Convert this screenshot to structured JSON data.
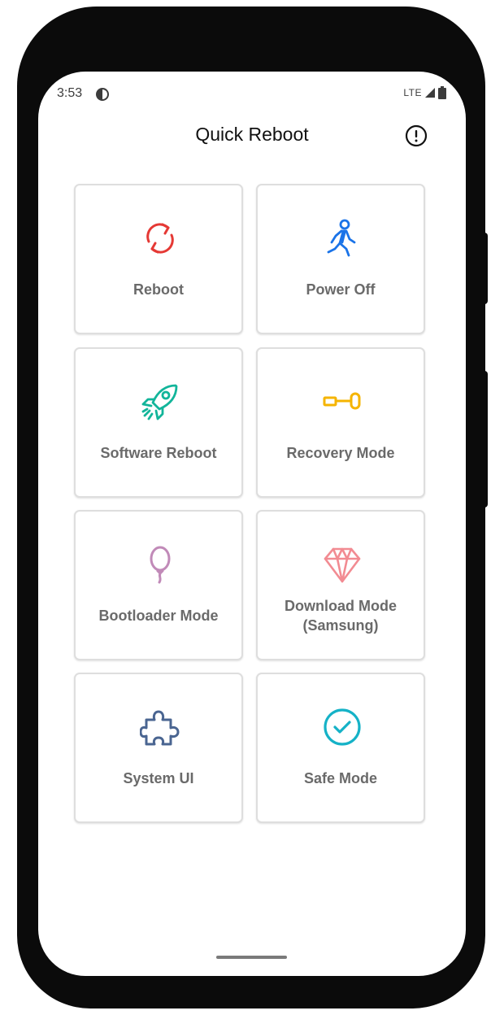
{
  "status_bar": {
    "time": "3:53",
    "network": "LTE"
  },
  "header": {
    "title": "Quick Reboot"
  },
  "tiles": [
    {
      "label": "Reboot",
      "icon": "refresh-icon",
      "color": "#e53935"
    },
    {
      "label": "Power Off",
      "icon": "walking-person-icon",
      "color": "#1a73e8"
    },
    {
      "label": "Software Reboot",
      "icon": "rocket-icon",
      "color": "#12b59a"
    },
    {
      "label": "Recovery Mode",
      "icon": "key-icon",
      "color": "#f5b400"
    },
    {
      "label": "Bootloader Mode",
      "icon": "balloon-icon",
      "color": "#c18ab8"
    },
    {
      "label": "Download Mode\n(Samsung)",
      "icon": "diamond-icon",
      "color": "#f28b92"
    },
    {
      "label": "System UI",
      "icon": "puzzle-icon",
      "color": "#4a6591"
    },
    {
      "label": "Safe Mode",
      "icon": "check-circle-icon",
      "color": "#15b2c7"
    }
  ]
}
